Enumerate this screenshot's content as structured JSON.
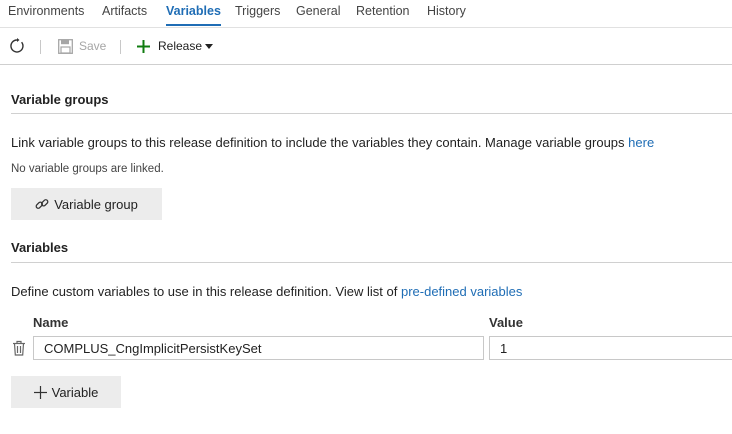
{
  "tabs": [
    {
      "label": "Environments",
      "active": false
    },
    {
      "label": "Artifacts",
      "active": false
    },
    {
      "label": "Variables",
      "active": true
    },
    {
      "label": "Triggers",
      "active": false
    },
    {
      "label": "General",
      "active": false
    },
    {
      "label": "Retention",
      "active": false
    },
    {
      "label": "History",
      "active": false
    }
  ],
  "toolbar": {
    "refresh_icon": "refresh-icon",
    "save_label": "Save",
    "save_enabled": false,
    "release_label": "Release"
  },
  "variable_groups": {
    "title": "Variable groups",
    "description": "Link variable groups to this release definition to include the variables they contain. Manage variable groups ",
    "manage_link": "here",
    "empty_note": "No variable groups are linked.",
    "add_button_label": "Variable group"
  },
  "variables": {
    "title": "Variables",
    "description": "Define custom variables to use in this release definition. View list of ",
    "predefined_link": "pre-defined variables",
    "columns": {
      "name": "Name",
      "value": "Value"
    },
    "rows": [
      {
        "name": "COMPLUS_CngImplicitPersistKeySet",
        "value": "1"
      }
    ],
    "add_button_label": "Variable"
  },
  "colors": {
    "accent": "#1f6db5",
    "add_green": "#107c10",
    "button_bg": "#ececec"
  }
}
